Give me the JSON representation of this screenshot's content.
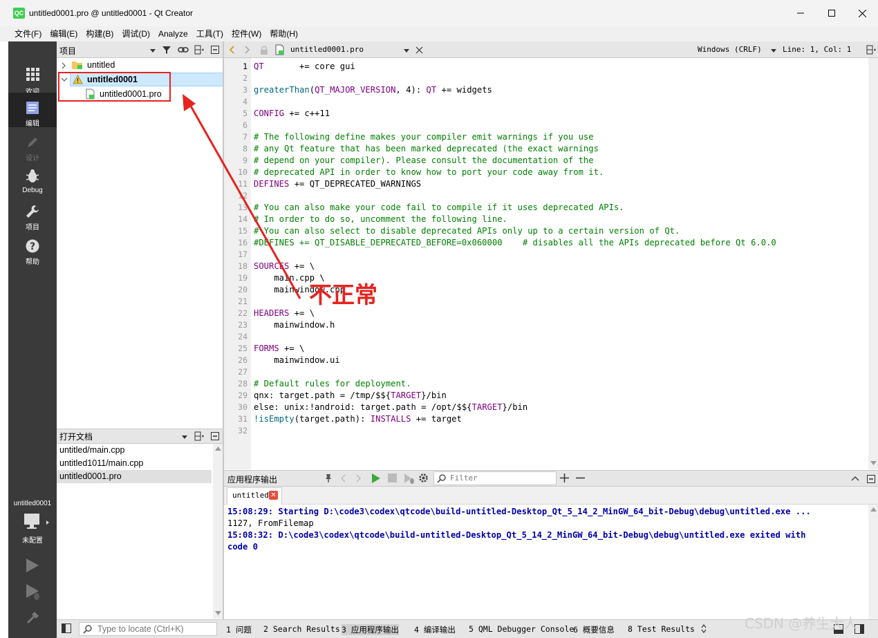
{
  "window": {
    "title": "untitled0001.pro @ untitled0001 - Qt Creator",
    "app_icon": "QC"
  },
  "menu": [
    "文件(F)",
    "编辑(E)",
    "构建(B)",
    "调试(D)",
    "Analyze",
    "工具(T)",
    "控件(W)",
    "帮助(H)"
  ],
  "modes": [
    {
      "label": "欢迎",
      "icon": "grid-icon"
    },
    {
      "label": "编辑",
      "icon": "document-icon",
      "active": true
    },
    {
      "label": "设计",
      "icon": "pencil-icon",
      "disabled": true
    },
    {
      "label": "Debug",
      "icon": "bug-icon"
    },
    {
      "label": "项目",
      "icon": "wrench-icon"
    },
    {
      "label": "帮助",
      "icon": "help-icon"
    }
  ],
  "kit": {
    "name": "untitled0001",
    "state": "未配置"
  },
  "projects": {
    "title": "项目",
    "items": [
      {
        "label": "untitled",
        "expanded": false
      },
      {
        "label": "untitled0001",
        "expanded": true,
        "warning": true,
        "selected": true
      },
      {
        "label": "untitled0001.pro"
      }
    ]
  },
  "open_docs": {
    "title": "打开文档",
    "items": [
      "untitled/main.cpp",
      "untitled1011/main.cpp",
      "untitled0001.pro"
    ],
    "selected_index": 2
  },
  "editor": {
    "file": "untitled0001.pro",
    "line_ending": "Windows (CRLF)",
    "position": "Line: 1, Col: 1",
    "current_line": 1,
    "lines": [
      [
        [
          "kw",
          "QT"
        ],
        [
          "",
          "       += core gui"
        ]
      ],
      [],
      [
        [
          "fn",
          "greaterThan"
        ],
        [
          "",
          "("
        ],
        [
          "kw",
          "QT_MAJOR_VERSION"
        ],
        [
          "",
          ", 4): "
        ],
        [
          "kw",
          "QT"
        ],
        [
          "",
          " += widgets"
        ]
      ],
      [],
      [
        [
          "kw",
          "CONFIG"
        ],
        [
          "",
          " += c++11"
        ]
      ],
      [],
      [
        [
          "cm",
          "# The following define makes your compiler emit warnings if you use"
        ]
      ],
      [
        [
          "cm",
          "# any Qt feature that has been marked deprecated (the exact warnings"
        ]
      ],
      [
        [
          "cm",
          "# depend on your compiler). Please consult the documentation of the"
        ]
      ],
      [
        [
          "cm",
          "# deprecated API in order to know how to port your code away from it."
        ]
      ],
      [
        [
          "kw",
          "DEFINES"
        ],
        [
          "",
          " += QT_DEPRECATED_WARNINGS"
        ]
      ],
      [],
      [
        [
          "cm",
          "# You can also make your code fail to compile if it uses deprecated APIs."
        ]
      ],
      [
        [
          "cm",
          "# In order to do so, uncomment the following line."
        ]
      ],
      [
        [
          "cm",
          "# You can also select to disable deprecated APIs only up to a certain version of Qt."
        ]
      ],
      [
        [
          "cm",
          "#DEFINES += QT_DISABLE_DEPRECATED_BEFORE=0x060000    # disables all the APIs deprecated before Qt 6.0.0"
        ]
      ],
      [],
      [
        [
          "kw",
          "SOURCES"
        ],
        [
          "",
          " += \\"
        ]
      ],
      [
        [
          "",
          "    main.cpp \\"
        ]
      ],
      [
        [
          "",
          "    mainwindow.cpp"
        ]
      ],
      [],
      [
        [
          "kw",
          "HEADERS"
        ],
        [
          "",
          " += \\"
        ]
      ],
      [
        [
          "",
          "    mainwindow.h"
        ]
      ],
      [],
      [
        [
          "kw",
          "FORMS"
        ],
        [
          "",
          " += \\"
        ]
      ],
      [
        [
          "",
          "    mainwindow.ui"
        ]
      ],
      [],
      [
        [
          "cm",
          "# Default rules for deployment."
        ]
      ],
      [
        [
          "",
          "qnx: target.path = /tmp/$${"
        ],
        [
          "kw",
          "TARGET"
        ],
        [
          "",
          "}/bin"
        ]
      ],
      [
        [
          "",
          "else: unix:!android: target.path = /opt/$${"
        ],
        [
          "kw",
          "TARGET"
        ],
        [
          "",
          "}/bin"
        ]
      ],
      [
        [
          "fn",
          "!isEmpty"
        ],
        [
          "",
          "(target.path): "
        ],
        [
          "kw",
          "INSTALLS"
        ],
        [
          "",
          " += target"
        ]
      ],
      []
    ]
  },
  "output": {
    "title": "应用程序输出",
    "filter_placeholder": "Filter",
    "tab": "untitled",
    "lines": [
      {
        "text": "15:08:29: Starting D:\\code3\\codex\\qtcode\\build-untitled-Desktop_Qt_5_14_2_MinGW_64_bit-Debug\\debug\\untitled.exe ...",
        "bold": true
      },
      {
        "text": "1127, FromFilemap",
        "bold": false
      },
      {
        "text": "15:08:32: D:\\code3\\codex\\qtcode\\build-untitled-Desktop_Qt_5_14_2_MinGW_64_bit-Debug\\debug\\untitled.exe exited with",
        "bold": true
      },
      {
        "text": "code 0",
        "bold": true
      }
    ]
  },
  "statusbar": {
    "locator_placeholder": "Type to locate (Ctrl+K)",
    "tabs": [
      "1 问题",
      "2 Search Results",
      "3 应用程序输出",
      "4 编译输出",
      "5 QML Debugger Console",
      "6 概要信息",
      "8 Test Results"
    ],
    "active_index": 2
  },
  "annotation": {
    "text": "不正常",
    "color": "#e5231f"
  },
  "watermark": "CSDN @养生大人",
  "colors": {
    "keyword": "#800080",
    "function": "#00677c",
    "comment": "#008000",
    "output_bold": "#0000aa",
    "sidebar": "#3a3a3a",
    "accent": "#e5231f"
  }
}
